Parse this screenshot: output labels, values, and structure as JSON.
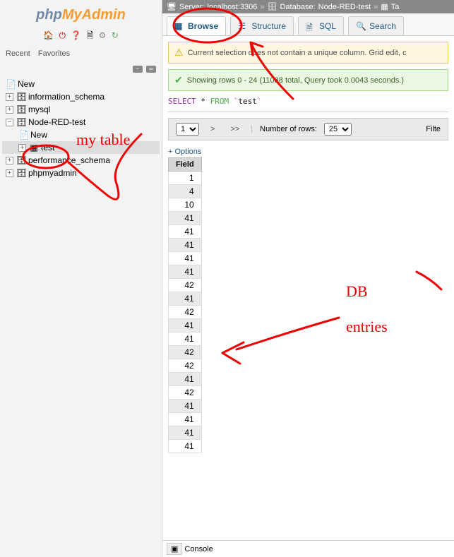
{
  "logo": {
    "php": "php",
    "my": "My",
    "admin": "Admin"
  },
  "sidebar_tabs": {
    "recent": "Recent",
    "favorites": "Favorites"
  },
  "tree": {
    "new": "New",
    "information_schema": "information_schema",
    "mysql": "mysql",
    "node_red_test": "Node-RED-test",
    "node_new": "New",
    "node_test": "test",
    "performance_schema": "performance_schema",
    "phpmyadmin": "phpmyadmin"
  },
  "breadcrumb": {
    "server_label": "Server:",
    "server_value": "localhost:3306",
    "db_label": "Database:",
    "db_value": "Node-RED-test",
    "table_label": "Ta"
  },
  "tabs": {
    "browse": "Browse",
    "structure": "Structure",
    "sql": "SQL",
    "search": "Search"
  },
  "warning": "Current selection does not contain a unique column. Grid edit, c",
  "success": "Showing rows 0 - 24 (11088 total, Query took 0.0043 seconds.)",
  "sql": {
    "select": "SELECT",
    "star": "*",
    "from": "FROM",
    "table": "test"
  },
  "nav": {
    "page": "1",
    "next": ">",
    "last": ">>",
    "rows_label": "Number of rows:",
    "rows_value": "25",
    "filter": "Filte"
  },
  "options": "+ Options",
  "column_header": "Field",
  "rows": [
    1,
    4,
    10,
    41,
    41,
    41,
    41,
    41,
    42,
    41,
    42,
    41,
    41,
    42,
    42,
    41,
    42,
    41,
    41,
    41,
    41
  ],
  "console": "Console",
  "annotations": {
    "my_table": "my table",
    "db_entries": "DB entries"
  }
}
